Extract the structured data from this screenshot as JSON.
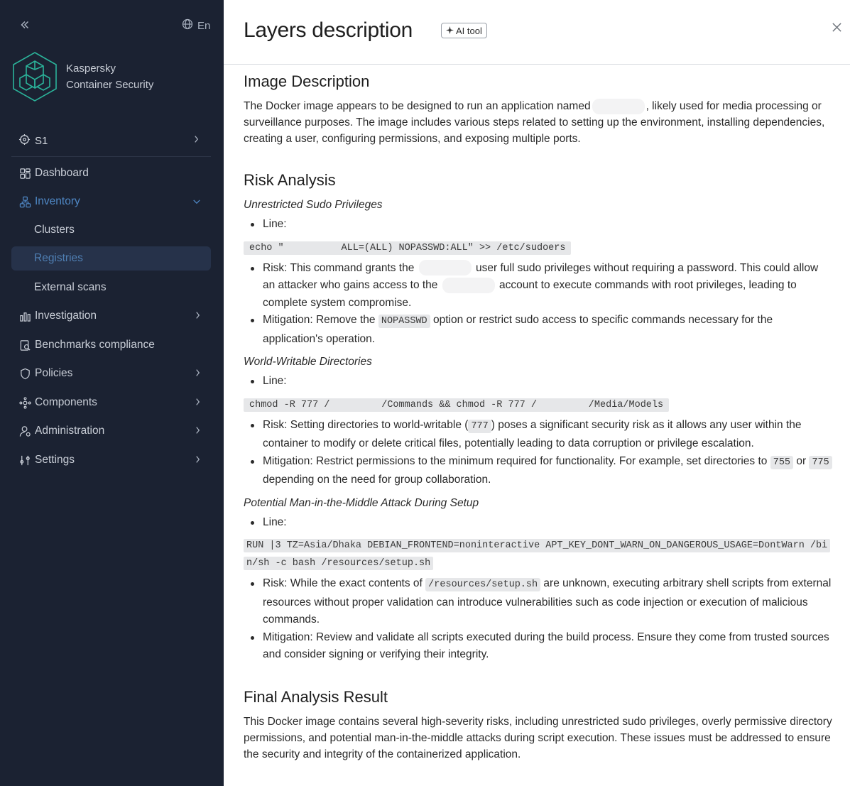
{
  "sidebar": {
    "lang": "En",
    "brand_line1": "Kaspersky",
    "brand_line2": "Container Security",
    "scope": "S1",
    "items": [
      {
        "label": "Dashboard"
      },
      {
        "label": "Inventory"
      },
      {
        "label": "Clusters"
      },
      {
        "label": "Registries"
      },
      {
        "label": "External scans"
      },
      {
        "label": "Investigation"
      },
      {
        "label": "Benchmarks compliance"
      },
      {
        "label": "Policies"
      },
      {
        "label": "Components"
      },
      {
        "label": "Administration"
      },
      {
        "label": "Settings"
      }
    ]
  },
  "panel": {
    "title": "Layers description",
    "badge": "AI tool",
    "image_description": {
      "heading": "Image Description",
      "text_a": "The Docker image appears to be designed to run an application named",
      "text_b": ", likely used for media processing or surveillance purposes. The image includes various steps related to setting up the environment, installing dependencies, creating a user, configuring permissions, and exposing multiple ports."
    },
    "risk_analysis": {
      "heading": "Risk Analysis",
      "line_label": "Line:",
      "risk1": {
        "title": "Unrestricted Sudo Privileges",
        "code_a": "echo \"",
        "code_b": " ALL=(ALL) NOPASSWD:ALL\" >> /etc/sudoers",
        "risk_a": "Risk: This command grants the",
        "risk_b": "user full sudo privileges without requiring a password. This could allow an attacker who gains access to the",
        "risk_c": "account to execute commands with root privileges, leading to complete system compromise.",
        "mit_a": "Mitigation: Remove the",
        "mit_code": "NOPASSWD",
        "mit_b": "option or restrict sudo access to specific commands necessary for the application's operation."
      },
      "risk2": {
        "title": "World-Writable Directories",
        "code_a": "chmod -R 777 /",
        "code_b": "/Commands && chmod -R 777 /",
        "code_c": "/Media/Models",
        "risk_a": "Risk: Setting directories to world-writable (",
        "risk_code": "777",
        "risk_b": ") poses a significant security risk as it allows any user within the container to modify or delete critical files, potentially leading to data corruption or privilege escalation.",
        "mit_a": "Mitigation: Restrict permissions to the minimum required for functionality. For example, set directories to",
        "mit_code1": "755",
        "mit_or": "or",
        "mit_code2": "775",
        "mit_b": "depending on the need for group collaboration."
      },
      "risk3": {
        "title": "Potential Man-in-the-Middle Attack During Setup",
        "code": "RUN |3 TZ=Asia/Dhaka DEBIAN_FRONTEND=noninteractive APT_KEY_DONT_WARN_ON_DANGEROUS_USAGE=DontWarn /bin/sh -c bash /resources/setup.sh",
        "risk_a": "Risk: While the exact contents of",
        "risk_code": "/resources/setup.sh",
        "risk_b": "are unknown, executing arbitrary shell scripts from external resources without proper validation can introduce vulnerabilities such as code injection or execution of malicious commands.",
        "mit": "Mitigation: Review and validate all scripts executed during the build process. Ensure they come from trusted sources and consider signing or verifying their integrity."
      }
    },
    "final": {
      "heading": "Final Analysis Result",
      "text": "This Docker image contains several high-severity risks, including unrestricted sudo privileges, overly permissive directory permissions, and potential man-in-the-middle attacks during script execution. These issues must be addressed to ensure the security and integrity of the containerized application."
    }
  }
}
